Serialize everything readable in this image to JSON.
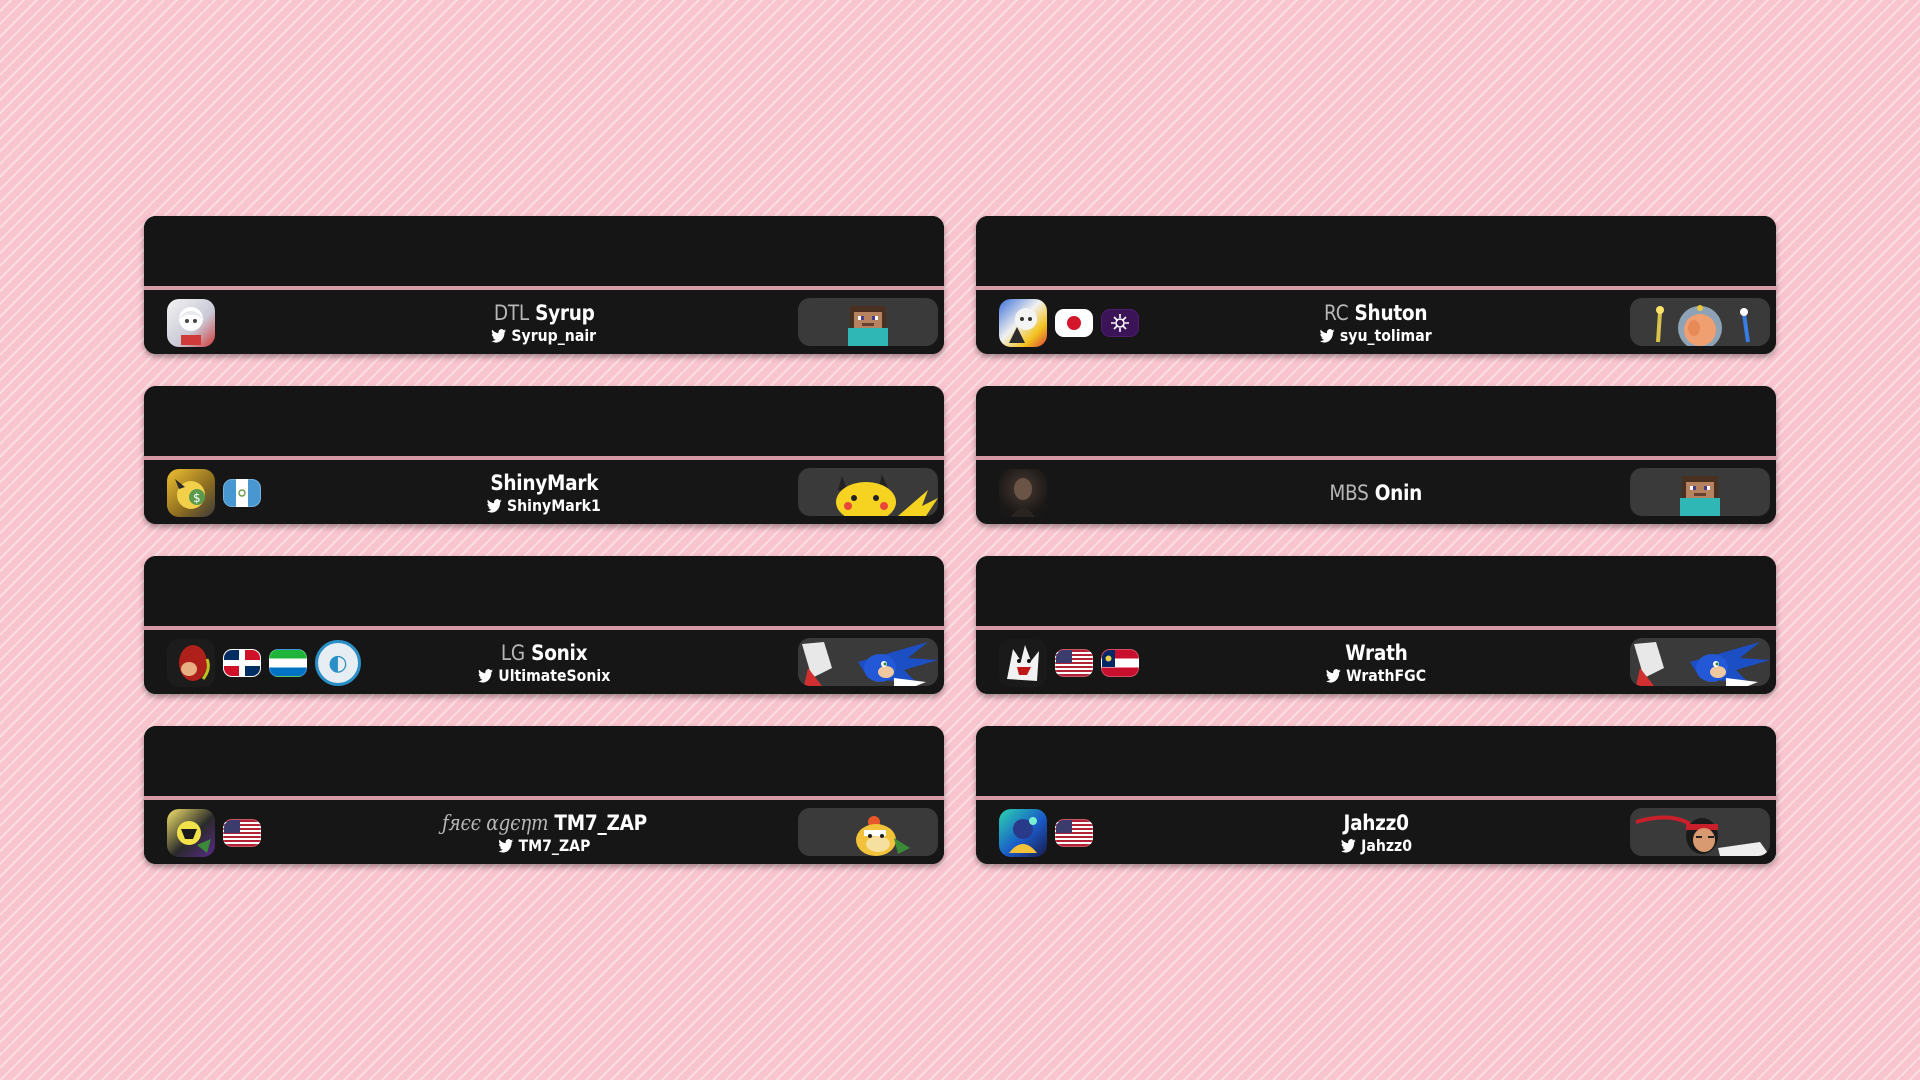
{
  "colors": {
    "background": "#f8c4ce",
    "card": "#121212",
    "separator": "#d59aa6",
    "prefix": "#b7b7b7",
    "text": "#ffffff"
  },
  "players": [
    {
      "prefix": "DTL",
      "name": "Syrup",
      "handle": "Syrup_nair",
      "avatar_icon": "white-haired-character-avatar-icon",
      "flags": [],
      "character_icon": "steve-minecraft-character-icon"
    },
    {
      "prefix": "RC",
      "name": "Shuton",
      "handle": "syu_tolimar",
      "avatar_icon": "character-avatar-icon",
      "flags": [
        "japan-flag-icon",
        "team-logo-purple-icon"
      ],
      "character_icon": "olimar-character-icon"
    },
    {
      "prefix": "",
      "name": "ShinyMark",
      "handle": "ShinyMark1",
      "avatar_icon": "pikachu-drawing-avatar-icon",
      "flags": [
        "guatemala-flag-icon"
      ],
      "character_icon": "pikachu-character-icon"
    },
    {
      "prefix": "MBS",
      "name": "Onin",
      "handle": "",
      "avatar_icon": "dark-portrait-avatar-icon",
      "flags": [],
      "character_icon": "steve-minecraft-character-icon"
    },
    {
      "prefix": "LG",
      "name": "Sonix",
      "handle": "UltimateSonix",
      "avatar_icon": "red-cartoon-avatar-icon",
      "flags": [
        "dominican-republic-flag-icon",
        "sierra-leone-flag-icon",
        "luminosity-gaming-logo-icon"
      ],
      "character_icon": "sonic-character-icon"
    },
    {
      "prefix": "",
      "name": "Wrath",
      "handle": "WrathFGC",
      "avatar_icon": "sketch-character-avatar-icon",
      "flags": [
        "usa-flag-icon",
        "georgia-state-flag-icon"
      ],
      "character_icon": "sonic-character-icon"
    },
    {
      "prefix": "ƒяєє αgєηт",
      "name": "TM7_ZAP",
      "handle": "TM7_ZAP",
      "avatar_icon": "yellow-character-avatar-icon",
      "flags": [
        "usa-flag-icon"
      ],
      "character_icon": "bowser-jr-character-icon"
    },
    {
      "prefix": "",
      "name": "Jahzz0",
      "handle": "Jahzz0",
      "avatar_icon": "colorful-character-avatar-icon",
      "flags": [
        "usa-flag-icon"
      ],
      "character_icon": "ryu-character-icon"
    }
  ]
}
